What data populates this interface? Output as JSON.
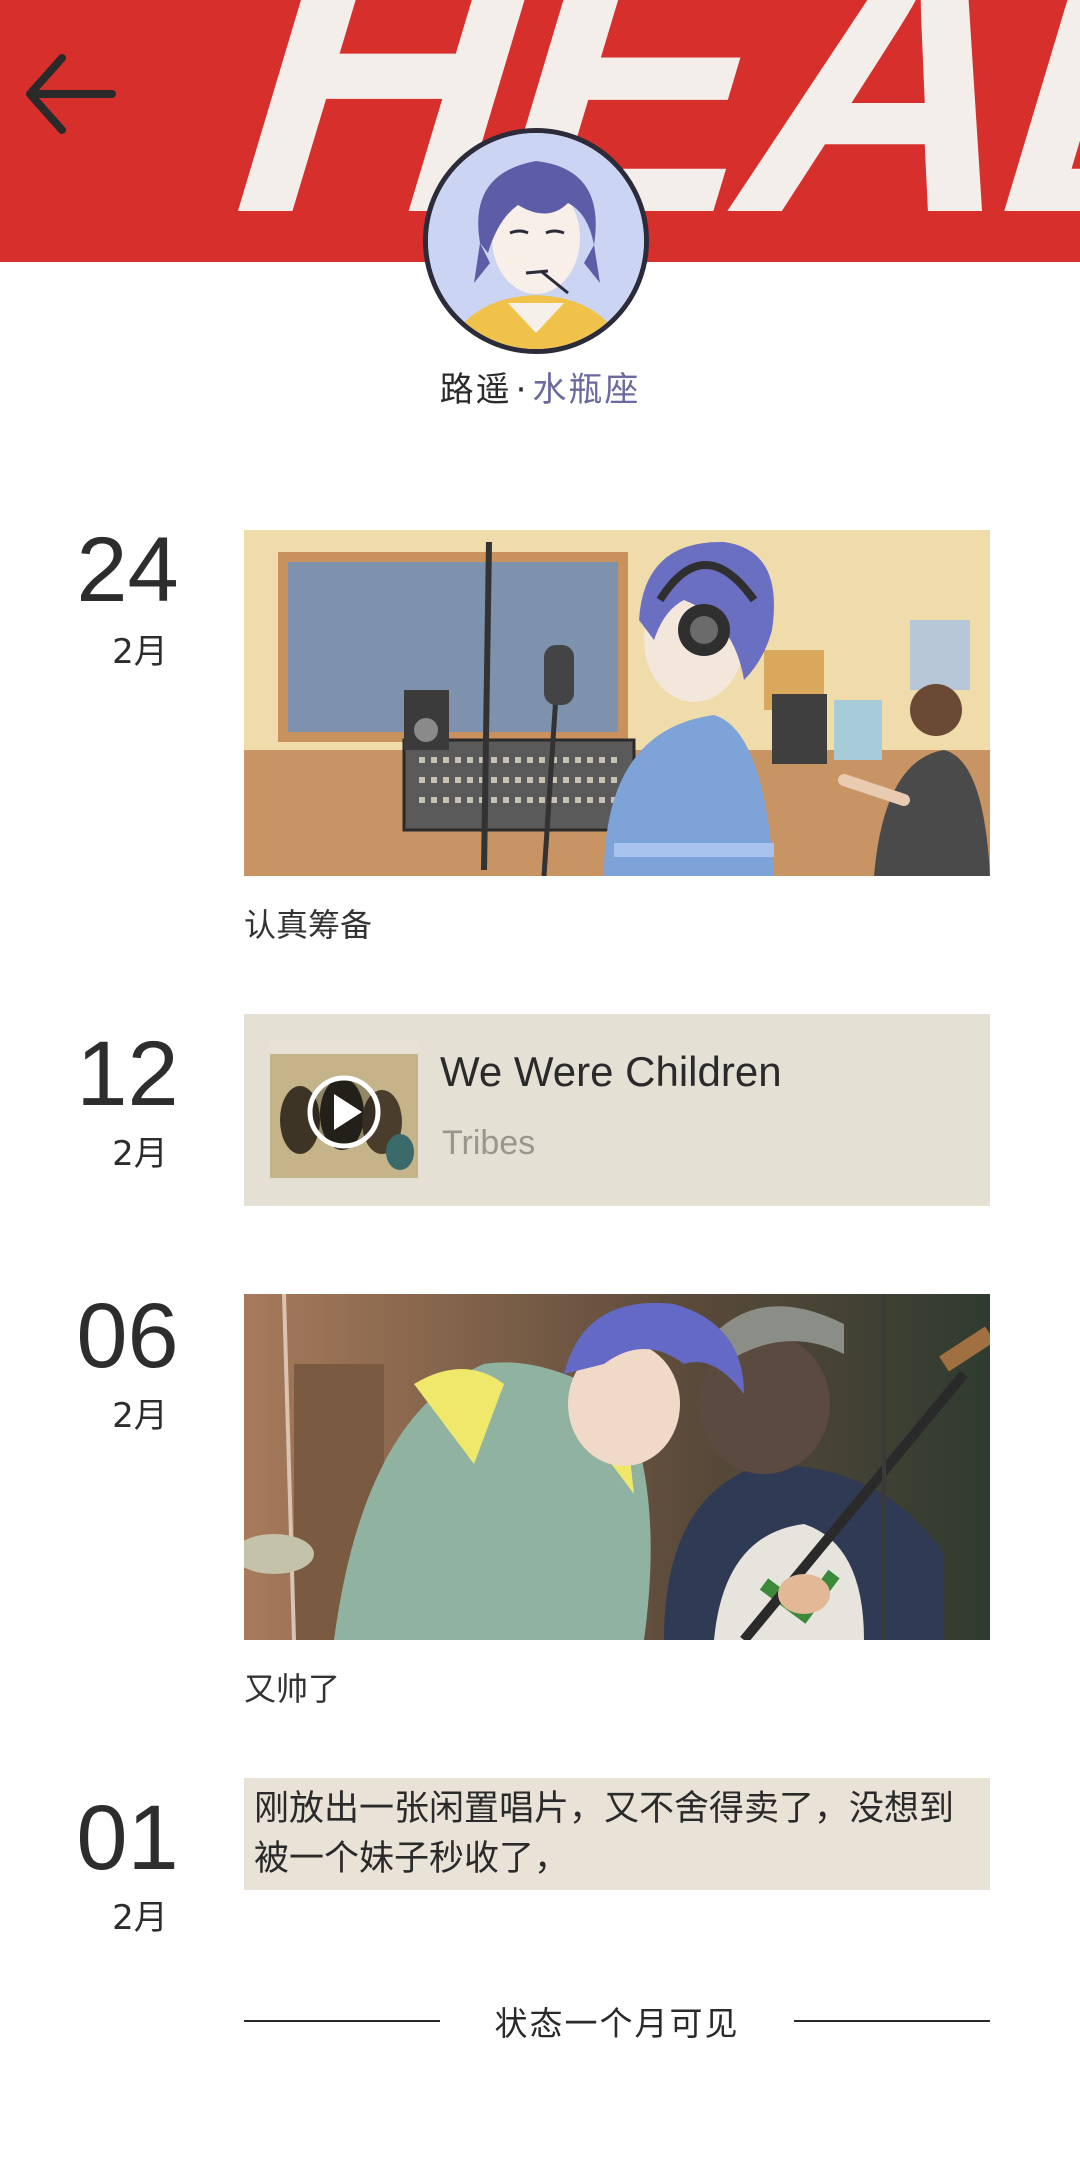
{
  "header": {
    "banner_text": "HEADS",
    "back_icon": "arrow-left-icon"
  },
  "profile": {
    "name": "路遥",
    "separator": "·",
    "zodiac": "水瓶座"
  },
  "posts": [
    {
      "day": "24",
      "month": "2月",
      "caption": "认真筹备"
    },
    {
      "day": "12",
      "month": "2月",
      "music": {
        "title": "We Were Children",
        "artist": "Tribes",
        "play_icon": "play-icon"
      }
    },
    {
      "day": "06",
      "month": "2月",
      "caption": "又帅了"
    },
    {
      "day": "01",
      "month": "2月",
      "text": "刚放出一张闲置唱片，又不舍得卖了，没想到被一个妹子秒收了，"
    }
  ],
  "footer": {
    "visibility_text": "状态一个月可见"
  },
  "colors": {
    "banner_red": "#d62f2c",
    "card_beige": "#e4e0d4",
    "zodiac_purple": "#6b6a9e"
  }
}
